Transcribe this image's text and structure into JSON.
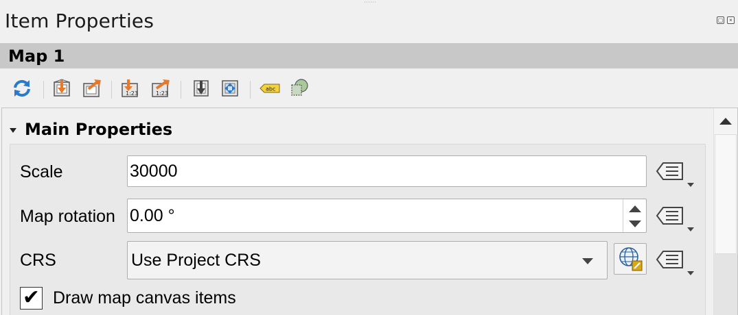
{
  "panel": {
    "title": "Item Properties",
    "float_icon": "float-icon",
    "close_icon": "close-icon"
  },
  "item": {
    "name": "Map 1"
  },
  "toolbar": {
    "buttons": [
      "refresh-icon",
      "set-extent-from-map-icon",
      "view-extent-in-map-icon",
      "set-scale-from-map-icon",
      "view-scale-in-map-icon",
      "move-to-feature-icon",
      "set-to-atlas-icon",
      "labeling-settings-icon",
      "clipping-settings-icon"
    ]
  },
  "section": {
    "title": "Main Properties"
  },
  "fields": {
    "scale": {
      "label": "Scale",
      "value": "30000"
    },
    "rotation": {
      "label": "Map rotation",
      "value": "0.00 °"
    },
    "crs": {
      "label": "CRS",
      "value": "Use Project CRS"
    }
  },
  "checkbox": {
    "label": "Draw map canvas items",
    "checked": true,
    "mark": "✔"
  },
  "colors": {
    "accent_orange": "#e8782a",
    "icon_blue": "#2a7ac9",
    "label_yellow": "#f5d13a"
  }
}
